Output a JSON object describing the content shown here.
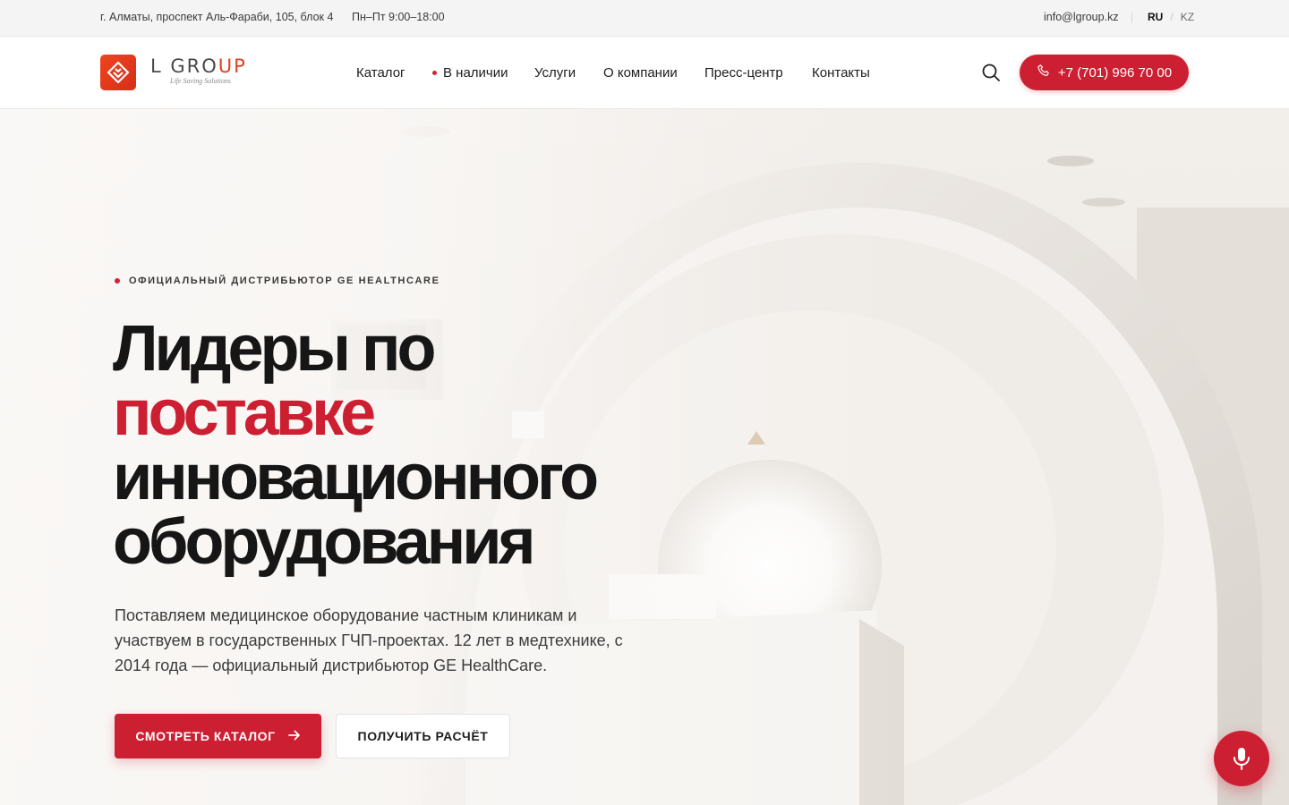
{
  "topbar": {
    "address": "г. Алматы, проспект Аль-Фараби, 105, блок 4",
    "hours": "Пн–Пт 9:00–18:00",
    "email": "info@lgroup.kz",
    "lang_active": "RU",
    "lang_other": "KZ",
    "lang_separator": "/"
  },
  "header": {
    "logo_text_main": "L GRO",
    "logo_text_accent": "UP",
    "logo_tagline": "Life Saving Solutions",
    "nav": [
      {
        "label": "Каталог"
      },
      {
        "label": "В наличии"
      },
      {
        "label": "Услуги"
      },
      {
        "label": "О компании"
      },
      {
        "label": "Пресс-центр"
      },
      {
        "label": "Контакты"
      }
    ],
    "phone": "+7 (701) 996 70 00"
  },
  "hero": {
    "eyebrow": "ОФИЦИАЛЬНЫЙ ДИСТРИБЬЮТОР GE HEALTHCARE",
    "headline_line1": "Лидеры по",
    "headline_accent": "поставке",
    "headline_line3": "инновационного",
    "headline_line4": "оборудования",
    "lead": "Поставляем медицинское оборудование частным клиникам и участвуем в государственных ГЧП-проектах. 12 лет в медтехнике, с 2014 года — официальный дистрибьютор GE HealthCare.",
    "primary_button": "СМОТРЕТЬ КАТАЛОГ",
    "secondary_button": "ПОЛУЧИТЬ РАСЧЁТ"
  },
  "icons": {
    "logo": "diamond-logo-icon",
    "search": "search-icon",
    "phone": "phone-icon",
    "arrow": "arrow-right-icon",
    "mic": "microphone-icon"
  },
  "colors": {
    "accent": "#cc1f32",
    "logo_orange": "#e2401f",
    "topbar_bg": "#f4f4f4",
    "text": "#1b1b1b"
  }
}
